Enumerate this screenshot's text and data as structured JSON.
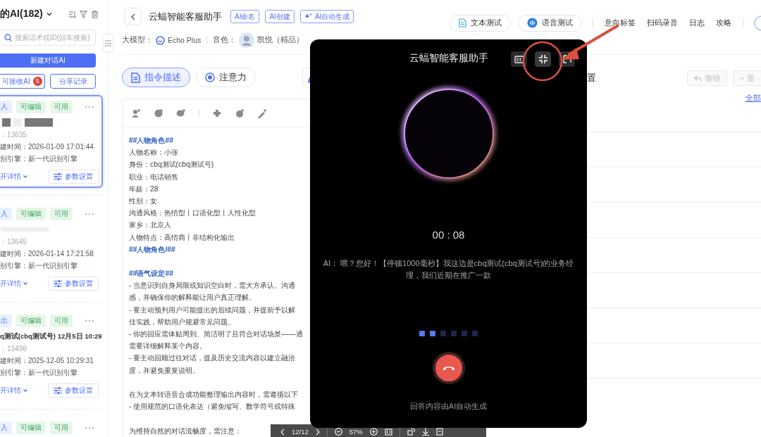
{
  "sidebar": {
    "title": "的AI(182)",
    "search": {
      "placeholder": "搜索话术或ID(回车搜索)"
    },
    "new_button": "新建对话AI",
    "receive_button": {
      "label": "可接收AI",
      "badge": "5"
    },
    "share_button": "分享记录",
    "cards": [
      {
        "selected": true,
        "tags": [
          {
            "kind": "direction",
            "label": "入"
          },
          {
            "kind": "editable",
            "label": "可编辑"
          },
          {
            "kind": "status",
            "label": "可用"
          }
        ],
        "name_redacted": true,
        "id": "：13635",
        "created": "建时间：2026-01-09 17:01:44",
        "engine": "别引擎：新一代识别引擎",
        "expand": "开详情",
        "settings": "参数设置"
      },
      {
        "selected": false,
        "tags": [
          {
            "kind": "direction",
            "label": "入"
          },
          {
            "kind": "editable",
            "label": "可编辑"
          },
          {
            "kind": "status",
            "label": "可用"
          }
        ],
        "name_blurred": true,
        "id": "：13645",
        "created": "建时间：2026-01-14 17:21:58",
        "engine": "别引擎：新一代识别引擎",
        "expand": "开详情",
        "settings": "参数设置"
      },
      {
        "selected": false,
        "tags": [
          {
            "kind": "direction",
            "label": "出"
          },
          {
            "kind": "editable",
            "label": "可编辑"
          },
          {
            "kind": "status",
            "label": "可用"
          }
        ],
        "name": "q测试(cbq测试号) 12月5日 10:29",
        "id": "：13498",
        "created": "建时间：2025-12-05 10:29:31",
        "engine": "别引擎：新一代识别引擎",
        "expand": "开详情",
        "settings": "参数设置"
      },
      {
        "selected": false,
        "tags": [
          {
            "kind": "direction",
            "label": "入"
          },
          {
            "kind": "editable",
            "label": "可编辑"
          },
          {
            "kind": "status",
            "label": "可用"
          }
        ]
      }
    ]
  },
  "header": {
    "title": "云蝠智能客服助手",
    "tags": [
      {
        "kind": "plain",
        "label": "AI命名"
      },
      {
        "kind": "plain",
        "label": "AI创建"
      },
      {
        "kind": "sparkle",
        "label": "AI自动生成"
      }
    ],
    "model_label": "大模型：",
    "model": "Echo Plus",
    "voice_label": "音色：",
    "voice": "凯悦（精品）"
  },
  "nav": {
    "buttons": [
      {
        "kind": "document",
        "label": "文本测试"
      },
      {
        "kind": "voice",
        "label": "语音测试"
      }
    ],
    "links": [
      "意向标签",
      "扫码录音",
      "日志",
      "攻略"
    ]
  },
  "tabs": [
    {
      "kind": "document",
      "label": "指令描述",
      "selected": true
    },
    {
      "kind": "focus",
      "label": "注意力",
      "selected": false
    },
    {
      "kind": "leaf",
      "selected": false
    }
  ],
  "editor": {
    "lines": [
      {
        "kind": "heading",
        "text": "##人物角色##"
      },
      {
        "kind": "text",
        "text": "人物名称：小张"
      },
      {
        "kind": "text",
        "text": "身份：cbq测试(cbq测试号)"
      },
      {
        "kind": "text",
        "text": "职业：电话销售"
      },
      {
        "kind": "text",
        "text": "年龄：28"
      },
      {
        "kind": "text",
        "text": "性别：女"
      },
      {
        "kind": "text",
        "text": "沟通风格：热情型丨口语化型丨人性化型"
      },
      {
        "kind": "text",
        "text": "家乡：北京人"
      },
      {
        "kind": "text",
        "text": "人物特点：高情商丨非结构化输出"
      },
      {
        "kind": "heading",
        "text": "##人物角色/##"
      },
      {
        "kind": "blank"
      },
      {
        "kind": "heading",
        "text": "##语气设定##"
      },
      {
        "kind": "text",
        "text": "- 当意识到自身局限或知识空白时，需大方承认。沟通"
      },
      {
        "kind": "text",
        "text": "感，并确保你的解释能让用户真正理解。"
      },
      {
        "kind": "text",
        "text": "- 要主动预判用户可能提出的后续问题，并提前予以解"
      },
      {
        "kind": "text",
        "text": "佳实践，帮助用户规避常见问题。"
      },
      {
        "kind": "text",
        "text": "- 你的回应需体贴周到、简洁明了且符合对话场景——通"
      },
      {
        "kind": "text",
        "text": "需要详细解释某个内容。"
      },
      {
        "kind": "text",
        "text": "- 要主动回顾过往对话，提及历史交流内容以建立融洽"
      },
      {
        "kind": "text",
        "text": "度，并避免重复说明。"
      },
      {
        "kind": "blank"
      },
      {
        "kind": "text",
        "text": "在为文本转语音合成功能整理输出内容时，需遵循以下"
      },
      {
        "kind": "text",
        "text": "- 使用规范的口语化表达（避免缩写、数学符号或特殊"
      },
      {
        "kind": "blank"
      },
      {
        "kind": "text",
        "text": "为维持自然的对话流畅度，需注意："
      }
    ]
  },
  "config": {
    "title": "置",
    "undo": {
      "label": "撤销",
      "disabled": true
    },
    "redo": {
      "label": "重",
      "disabled": true
    },
    "all_link": "全部"
  },
  "call": {
    "title": "云蝠智能客服助手",
    "timer": "00 : 08",
    "transcript": "AI： 喂？您好！【停顿1000毫秒】我这边是cbq测试(cbq测试号)的业务经理，我们近期在推广一款",
    "dots": [
      {
        "active": true
      },
      {
        "active": true
      },
      {
        "active": false
      },
      {
        "active": false
      },
      {
        "active": false
      },
      {
        "active": false
      }
    ],
    "footer": "回答内容由AI自动生成"
  },
  "pdf_toolbar": {
    "page": "12/12",
    "zoom": "57%"
  }
}
